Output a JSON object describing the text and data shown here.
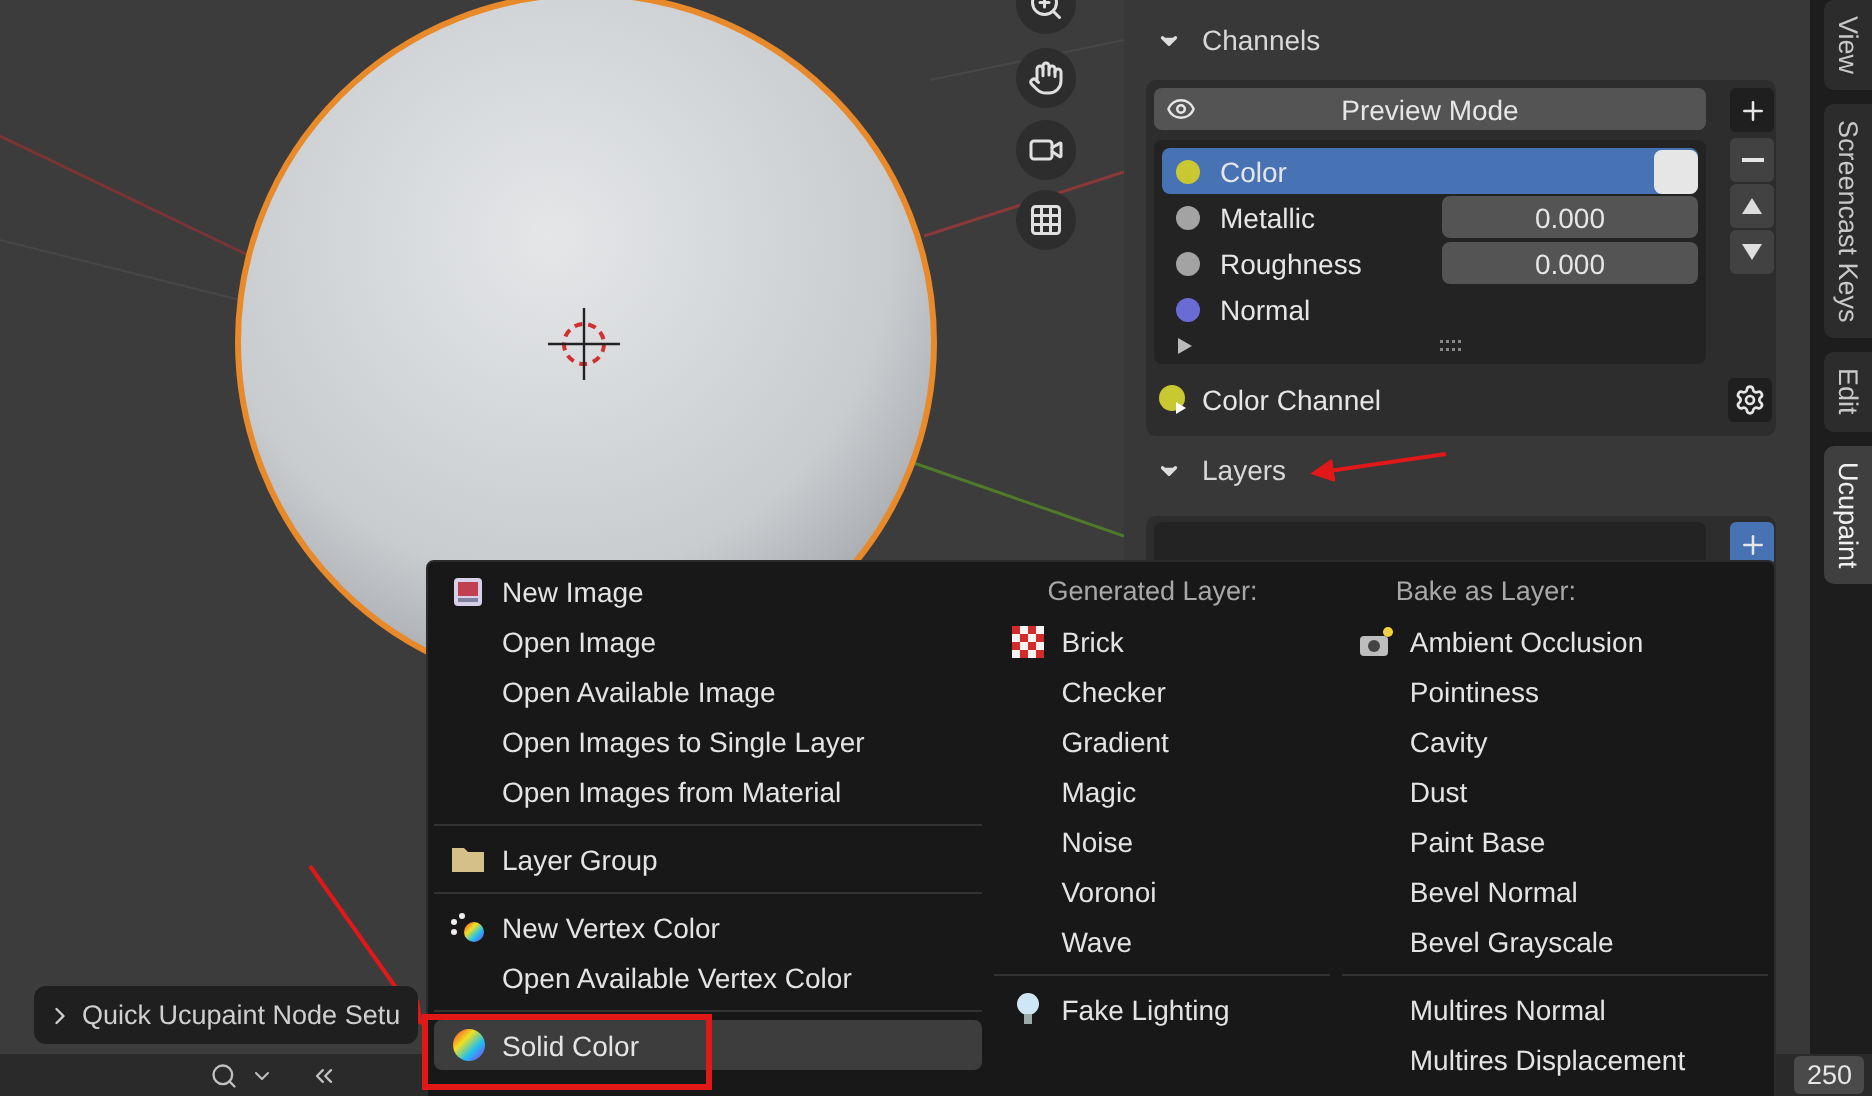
{
  "viewport": {
    "quick_setup": {
      "label": "Quick Ucupaint Node Setu",
      "expanded": false
    }
  },
  "panel": {
    "channels": {
      "title": "Channels",
      "expanded": true,
      "preview_button": "Preview Mode",
      "items": [
        {
          "name": "Color",
          "color": "#c9c832",
          "kind": "swatch",
          "selected": true
        },
        {
          "name": "Metallic",
          "color": "#a3a3a3",
          "kind": "number",
          "value": "0.000",
          "selected": false
        },
        {
          "name": "Roughness",
          "color": "#a3a3a3",
          "kind": "number",
          "value": "0.000",
          "selected": false
        },
        {
          "name": "Normal",
          "color": "#6b6bd6",
          "kind": "plain",
          "selected": false
        }
      ],
      "active_channel": "Color Channel"
    },
    "layers": {
      "title": "Layers",
      "expanded": true
    }
  },
  "side_tabs": [
    {
      "label": "View",
      "selected": false
    },
    {
      "label": "Screencast Keys",
      "selected": false
    },
    {
      "label": "Edit",
      "selected": false
    },
    {
      "label": "Ucupaint",
      "selected": true
    }
  ],
  "menu": {
    "columns": [
      {
        "groups": [
          [
            {
              "label": "New Image",
              "kind": "image",
              "selected": false
            },
            {
              "label": "Open Image",
              "selected": false
            },
            {
              "label": "Open Available Image",
              "selected": false
            },
            {
              "label": "Open Images to Single Layer",
              "selected": false
            },
            {
              "label": "Open Images from Material",
              "selected": false
            }
          ],
          [
            {
              "label": "Layer Group",
              "kind": "folder",
              "selected": false
            }
          ],
          [
            {
              "label": "New Vertex Color",
              "kind": "vertex",
              "selected": false
            },
            {
              "label": "Open Available Vertex Color",
              "selected": false
            }
          ],
          [
            {
              "label": "Solid Color",
              "kind": "wheel",
              "selected": true
            }
          ]
        ]
      },
      {
        "header": "Generated Layer:",
        "groups": [
          [
            {
              "label": "Brick",
              "kind": "checker",
              "selected": false
            },
            {
              "label": "Checker",
              "selected": false
            },
            {
              "label": "Gradient",
              "selected": false
            },
            {
              "label": "Magic",
              "selected": false
            },
            {
              "label": "Noise",
              "selected": false
            },
            {
              "label": "Voronoi",
              "selected": false
            },
            {
              "label": "Wave",
              "selected": false
            }
          ],
          [
            {
              "label": "Fake Lighting",
              "kind": "bulb",
              "selected": false
            }
          ]
        ]
      },
      {
        "header": "Bake as Layer:",
        "groups": [
          [
            {
              "label": "Ambient Occlusion",
              "kind": "camera",
              "selected": false
            },
            {
              "label": "Pointiness",
              "selected": false
            },
            {
              "label": "Cavity",
              "selected": false
            },
            {
              "label": "Dust",
              "selected": false
            },
            {
              "label": "Paint Base",
              "selected": false
            },
            {
              "label": "Bevel Normal",
              "selected": false
            },
            {
              "label": "Bevel Grayscale",
              "selected": false
            }
          ],
          [
            {
              "label": "Multires Normal",
              "selected": false
            },
            {
              "label": "Multires Displacement",
              "selected": false
            }
          ]
        ]
      }
    ]
  },
  "timeline": {
    "end_frame": "250"
  }
}
